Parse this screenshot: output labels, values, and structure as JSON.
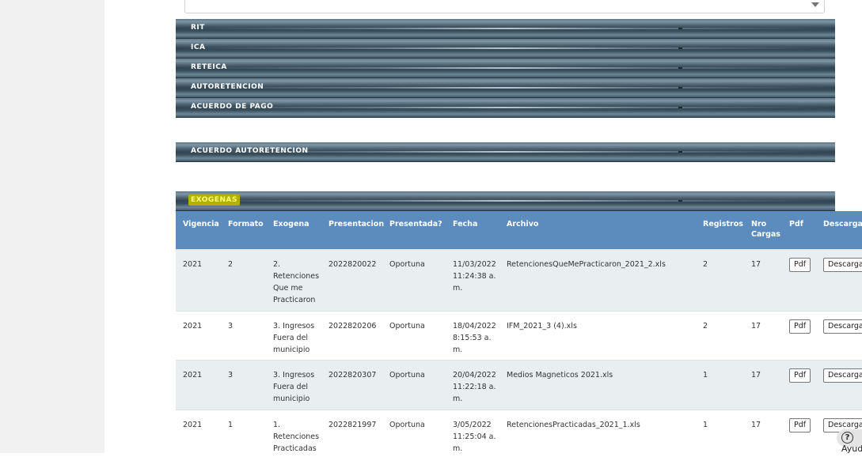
{
  "sections": {
    "group1": [
      "RIT",
      "ICA",
      "RETEICA",
      "AUTORETENCION",
      "ACUERDO DE PAGO"
    ],
    "acuerdo_autoretencion": "ACUERDO AUTORETENCION",
    "exogenas": "EXOGENAS"
  },
  "table": {
    "headers": [
      "Vigencia",
      "Formato",
      "Exogena",
      "Presentacion",
      "Presentada?",
      "Fecha",
      "Archivo",
      "Registros",
      "Nro Cargas",
      "Pdf",
      "Descargar Archivo"
    ],
    "rows": [
      {
        "vigencia": "2021",
        "formato": "2",
        "exogena": "2. Retenciones Que me Practicaron",
        "presentacion": "2022820022",
        "presentada": "Oportuna",
        "fecha": "11/03/2022 11:24:38 a. m.",
        "archivo": "RetencionesQueMePracticaron_2021_2.xls",
        "registros": "2",
        "cargas": "17",
        "pdf": "Pdf",
        "descargar": "Descargar"
      },
      {
        "vigencia": "2021",
        "formato": "3",
        "exogena": "3. Ingresos Fuera del municipio",
        "presentacion": "2022820206",
        "presentada": "Oportuna",
        "fecha": "18/04/2022 8:15:53 a. m.",
        "archivo": "IFM_2021_3 (4).xls",
        "registros": "2",
        "cargas": "17",
        "pdf": "Pdf",
        "descargar": "Descargar"
      },
      {
        "vigencia": "2021",
        "formato": "3",
        "exogena": "3. Ingresos Fuera del municipio",
        "presentacion": "2022820307",
        "presentada": "Oportuna",
        "fecha": "20/04/2022 11:22:18 a. m.",
        "archivo": "Medios Magneticos 2021.xls",
        "registros": "1",
        "cargas": "17",
        "pdf": "Pdf",
        "descargar": "Descargar"
      },
      {
        "vigencia": "2021",
        "formato": "1",
        "exogena": "1. Retenciones Practicadas",
        "presentacion": "2022821997",
        "presentada": "Oportuna",
        "fecha": "3/05/2022 11:25:04 a. m.",
        "archivo": "RetencionesPracticadas_2021_1.xls",
        "registros": "1",
        "cargas": "17",
        "pdf": "Pdf",
        "descargar": "Descargar"
      }
    ]
  },
  "help": {
    "icon": "question-circle-icon",
    "label": "Ayuda"
  },
  "colors": {
    "header_blue": "#5b8cbd",
    "highlight": "#b3b000",
    "bar": "#3b5160"
  }
}
